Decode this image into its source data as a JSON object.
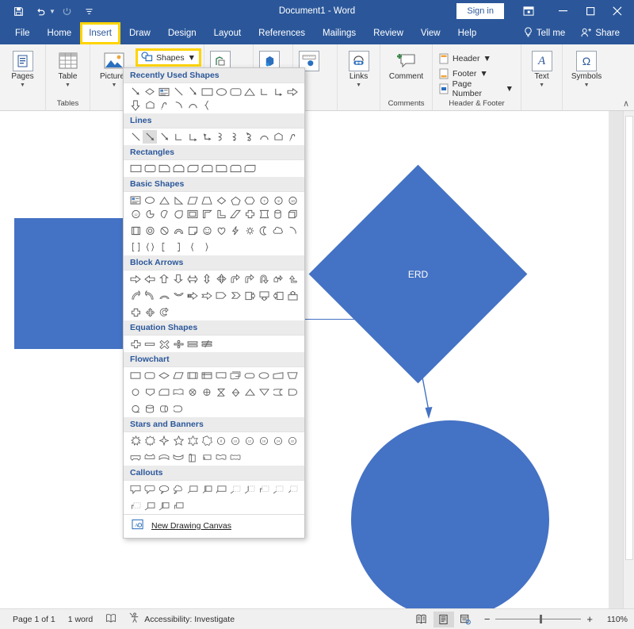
{
  "titlebar": {
    "document_title": "Document1  -  Word",
    "quick_access": [
      {
        "name": "save-icon",
        "glyph": "὚B"
      },
      {
        "name": "undo-icon",
        "glyph": "↶"
      },
      {
        "name": "redo-icon",
        "glyph": "↻"
      },
      {
        "name": "customize-qat-icon",
        "glyph": "☷"
      }
    ],
    "sign_in_label": "Sign in",
    "ribbon_display_options": "❐",
    "minimize": "─",
    "maximize": "☐",
    "close": "✕"
  },
  "tabs": [
    {
      "label": "File",
      "active": false
    },
    {
      "label": "Home",
      "active": false
    },
    {
      "label": "Insert",
      "active": true
    },
    {
      "label": "Draw",
      "active": false
    },
    {
      "label": "Design",
      "active": false
    },
    {
      "label": "Layout",
      "active": false
    },
    {
      "label": "References",
      "active": false
    },
    {
      "label": "Mailings",
      "active": false
    },
    {
      "label": "Review",
      "active": false
    },
    {
      "label": "View",
      "active": false
    },
    {
      "label": "Help",
      "active": false
    }
  ],
  "tabbar_right": {
    "tell_me_label": "Tell me",
    "share_label": "Share"
  },
  "ribbon": {
    "groups": [
      {
        "label": "",
        "buttons": [
          {
            "label": "Pages",
            "icon": "pages-icon",
            "has_dropdown": true
          }
        ]
      },
      {
        "label": "Tables",
        "buttons": [
          {
            "label": "Table",
            "icon": "table-icon",
            "has_dropdown": true
          }
        ]
      },
      {
        "label": "",
        "buttons": [
          {
            "label": "Pictures",
            "icon": "pictures-icon",
            "has_dropdown": true
          }
        ]
      },
      {
        "label": "",
        "buttons": [
          {
            "label": "Shapes",
            "icon": "shapes-icon",
            "has_dropdown": true,
            "highlighted": true
          },
          {
            "label": "",
            "icon": "icons-icon",
            "has_dropdown": false
          },
          {
            "label": "",
            "icon": "3d-models-icon",
            "has_dropdown": false
          },
          {
            "label": "",
            "icon": "smartart-icon",
            "has_dropdown": false
          }
        ]
      },
      {
        "label": "",
        "buttons": [
          {
            "label": "Links",
            "icon": "links-icon",
            "has_dropdown": true
          }
        ]
      },
      {
        "label": "Comments",
        "buttons": [
          {
            "label": "Comment",
            "icon": "comment-icon",
            "has_dropdown": false
          }
        ]
      },
      {
        "label": "Header & Footer",
        "buttons": [
          {
            "label": "Header",
            "icon": "header-icon",
            "has_dropdown": true
          },
          {
            "label": "Footer",
            "icon": "footer-icon",
            "has_dropdown": true
          },
          {
            "label": "Page Number",
            "icon": "page-number-icon",
            "has_dropdown": true
          }
        ]
      },
      {
        "label": "",
        "buttons": [
          {
            "label": "Text",
            "icon": "text-icon",
            "has_dropdown": true
          }
        ]
      },
      {
        "label": "",
        "buttons": [
          {
            "label": "Symbols",
            "icon": "symbols-icon",
            "has_dropdown": true
          }
        ]
      }
    ],
    "collapse_icon": "∧"
  },
  "shapes_menu": {
    "sections": [
      {
        "title": "Recently Used Shapes",
        "count": 22
      },
      {
        "title": "Lines",
        "count": 12,
        "selected_index": 1
      },
      {
        "title": "Rectangles",
        "count": 9
      },
      {
        "title": "Basic Shapes",
        "count": 46
      },
      {
        "title": "Block Arrows",
        "count": 27
      },
      {
        "title": "Equation Shapes",
        "count": 6
      },
      {
        "title": "Flowchart",
        "count": 28
      },
      {
        "title": "Stars and Banners",
        "count": 18
      },
      {
        "title": "Callouts",
        "count": 16
      }
    ],
    "footer": {
      "label": "New Drawing Canvas",
      "icon": "new-drawing-canvas-icon"
    }
  },
  "canvas": {
    "shapes": [
      {
        "name": "blue-rectangle",
        "type": "rectangle",
        "fill": "#4472C4",
        "label": ""
      },
      {
        "name": "blue-diamond",
        "type": "diamond",
        "fill": "#4472C4",
        "label": "ERD"
      },
      {
        "name": "blue-circle",
        "type": "circle",
        "fill": "#4472C4",
        "label": ""
      },
      {
        "name": "horizontal-connector",
        "type": "line",
        "stroke": "#4472C4"
      },
      {
        "name": "down-arrow-connector",
        "type": "arrow",
        "stroke": "#4472C4"
      }
    ]
  },
  "statusbar": {
    "page_info": "Page 1 of 1",
    "word_count": "1 word",
    "proofing_icon": "proofing-icon",
    "accessibility": "Accessibility: Investigate",
    "views": [
      {
        "name": "read-mode-view",
        "active": false
      },
      {
        "name": "print-layout-view",
        "active": true
      },
      {
        "name": "web-layout-view",
        "active": false
      }
    ],
    "zoom_out": "−",
    "zoom_in": "+",
    "zoom_level": "110%"
  },
  "colors": {
    "chrome_blue": "#2B579A",
    "shape_fill": "#4472C4",
    "highlight_yellow": "#FFD400",
    "ribbon_bg": "#F3F3F3"
  }
}
